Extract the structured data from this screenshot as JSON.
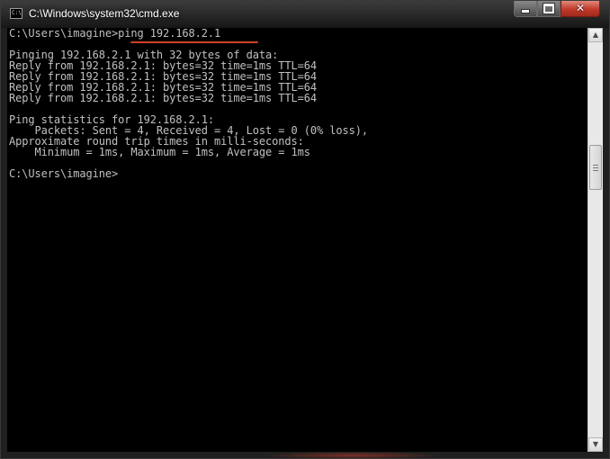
{
  "window": {
    "title": "C:\\Windows\\system32\\cmd.exe",
    "icon_text": "C:\\",
    "controls": {
      "minimize": "minimize-icon",
      "maximize": "maximize-icon",
      "close": "close-icon",
      "close_glyph": "✕"
    }
  },
  "console": {
    "lines": [
      "C:\\Users\\imagine>ping 192.168.2.1",
      "",
      "Pinging 192.168.2.1 with 32 bytes of data:",
      "Reply from 192.168.2.1: bytes=32 time=1ms TTL=64",
      "Reply from 192.168.2.1: bytes=32 time=1ms TTL=64",
      "Reply from 192.168.2.1: bytes=32 time=1ms TTL=64",
      "Reply from 192.168.2.1: bytes=32 time=1ms TTL=64",
      "",
      "Ping statistics for 192.168.2.1:",
      "    Packets: Sent = 4, Received = 4, Lost = 0 (0% loss),",
      "Approximate round trip times in milli-seconds:",
      "    Minimum = 1ms, Maximum = 1ms, Average = 1ms",
      "",
      "C:\\Users\\imagine>"
    ],
    "text_color": "#c0c0c0",
    "background": "#000000",
    "highlight_color": "#d0402a"
  },
  "scrollbar": {
    "up_arrow": "▲",
    "down_arrow": "▼"
  }
}
